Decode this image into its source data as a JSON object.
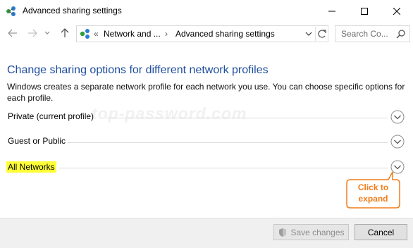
{
  "window": {
    "title": "Advanced sharing settings"
  },
  "address_bar": {
    "overflow": "«",
    "crumbs": [
      "Network and ...",
      "Advanced sharing settings"
    ],
    "separator": "›"
  },
  "search": {
    "placeholder": "Search Co..."
  },
  "main": {
    "heading": "Change sharing options for different network profiles",
    "description": "Windows creates a separate network profile for each network you use. You can choose specific options for each profile.",
    "watermark": "top-password.com",
    "sections": [
      {
        "label": "Private (current profile)",
        "state": "collapsed"
      },
      {
        "label": "Guest or Public",
        "state": "collapsed"
      },
      {
        "label": "All Networks",
        "state": "collapsed",
        "highlighted": true
      }
    ]
  },
  "callout": {
    "line1": "Click to",
    "line2": "expand",
    "color": "#f07d1a"
  },
  "footer": {
    "save_label": "Save changes",
    "cancel_label": "Cancel"
  },
  "colors": {
    "heading": "#1f4e9c",
    "highlight": "#ffff38",
    "callout": "#f07d1a"
  }
}
